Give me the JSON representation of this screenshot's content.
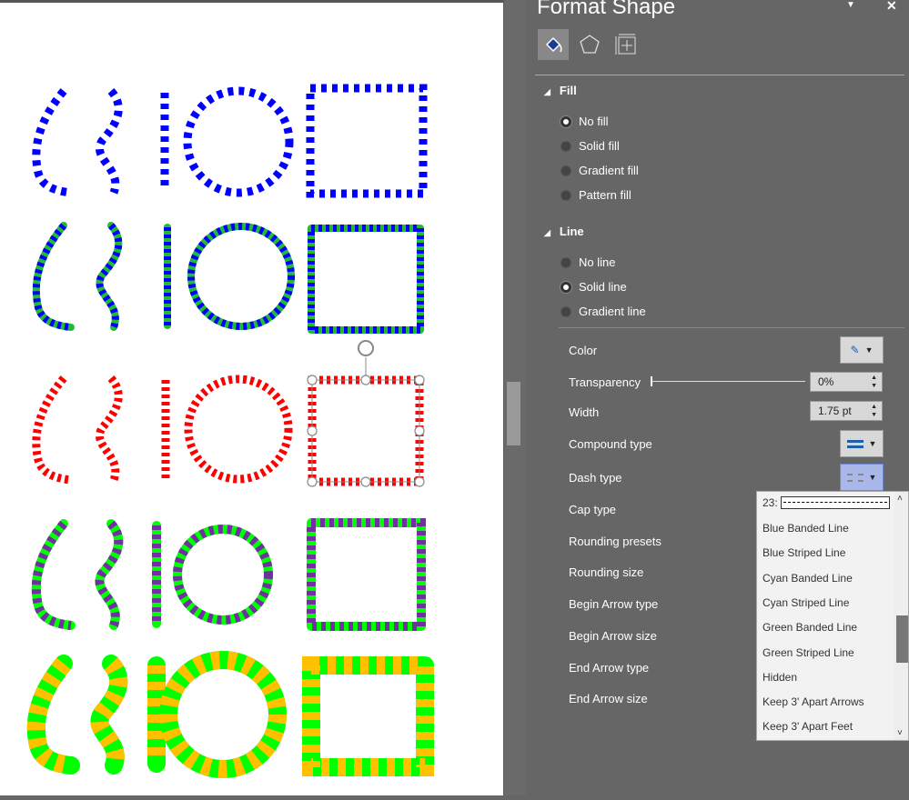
{
  "panel": {
    "title": "Format Shape",
    "tabs": [
      "fill-line",
      "effects",
      "size-properties"
    ],
    "fill": {
      "header": "Fill",
      "options": [
        {
          "label": "No fill",
          "selected": true
        },
        {
          "label": "Solid fill",
          "selected": false
        },
        {
          "label": "Gradient fill",
          "selected": false
        },
        {
          "label": "Pattern fill",
          "selected": false
        }
      ]
    },
    "line": {
      "header": "Line",
      "options": [
        {
          "label": "No line",
          "selected": false
        },
        {
          "label": "Solid line",
          "selected": true
        },
        {
          "label": "Gradient line",
          "selected": false
        }
      ]
    },
    "props": {
      "color": "Color",
      "transparency": "Transparency",
      "transparency_value": "0%",
      "width": "Width",
      "width_value": "1.75 pt",
      "compound": "Compound type",
      "dash": "Dash type",
      "cap": "Cap type",
      "rounding_presets": "Rounding presets",
      "rounding_size": "Rounding size",
      "begin_arrow_type": "Begin Arrow type",
      "begin_arrow_size": "Begin Arrow size",
      "end_arrow_type": "End Arrow type",
      "end_arrow_size": "End Arrow size"
    }
  },
  "dash_list": {
    "current": "23:",
    "items": [
      "Blue Banded Line",
      "Blue Striped Line",
      "Cyan Banded Line",
      "Cyan Striped Line",
      "Green Banded Line",
      "Green Striped Line",
      "Hidden",
      "Keep 3' Apart Arrows",
      "Keep 3' Apart Feet"
    ]
  },
  "colors": {
    "blue": "#0000ff",
    "green": "#22bb33",
    "red": "#ff0000",
    "purple": "#7030a0",
    "lime": "#00ff00",
    "yellow": "#ffc000",
    "panel": "#666666"
  }
}
